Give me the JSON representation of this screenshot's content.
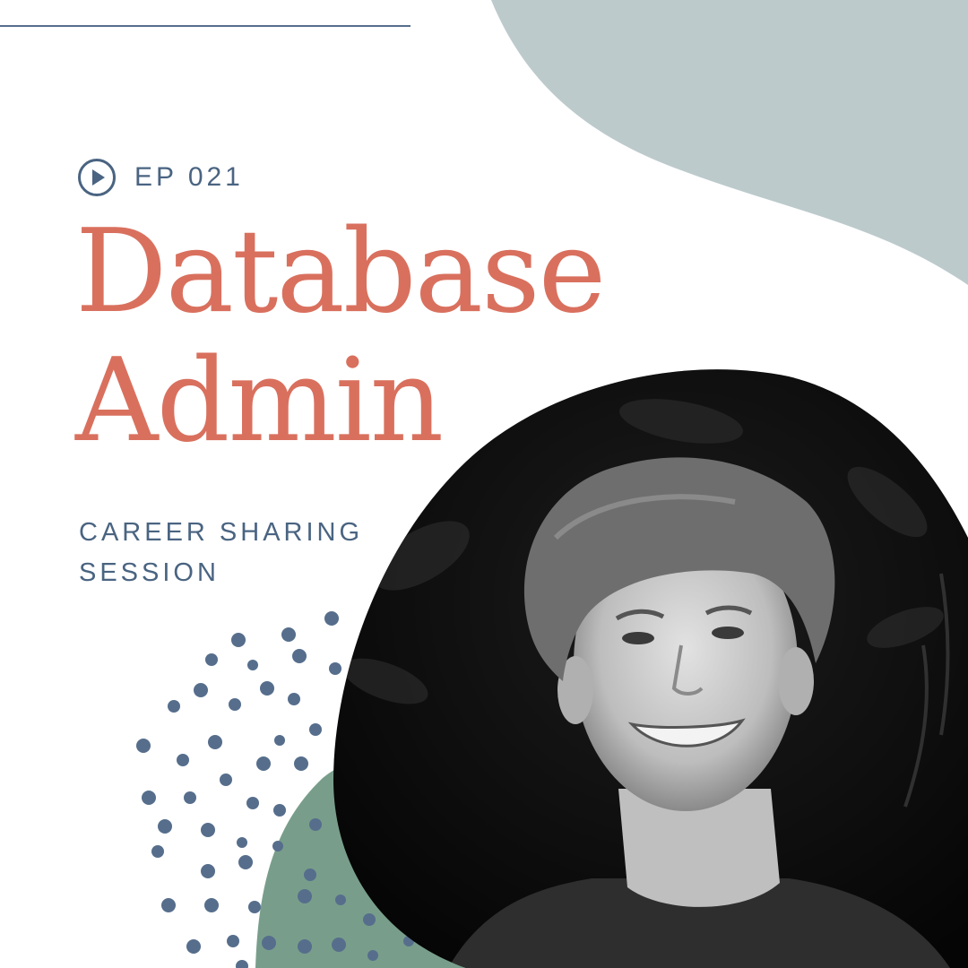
{
  "episode": {
    "icon": "play-circle-icon",
    "label": "EP 021"
  },
  "title": {
    "line1": "Database",
    "line2": "Admin"
  },
  "subtitle": {
    "line1": "CAREER SHARING",
    "line2": "SESSION"
  },
  "colors": {
    "accent": "#d9705e",
    "text_blue": "#4a6481",
    "blob_grey": "#bccacc",
    "blob_green": "#789e8b",
    "dots": "#566e8c"
  }
}
